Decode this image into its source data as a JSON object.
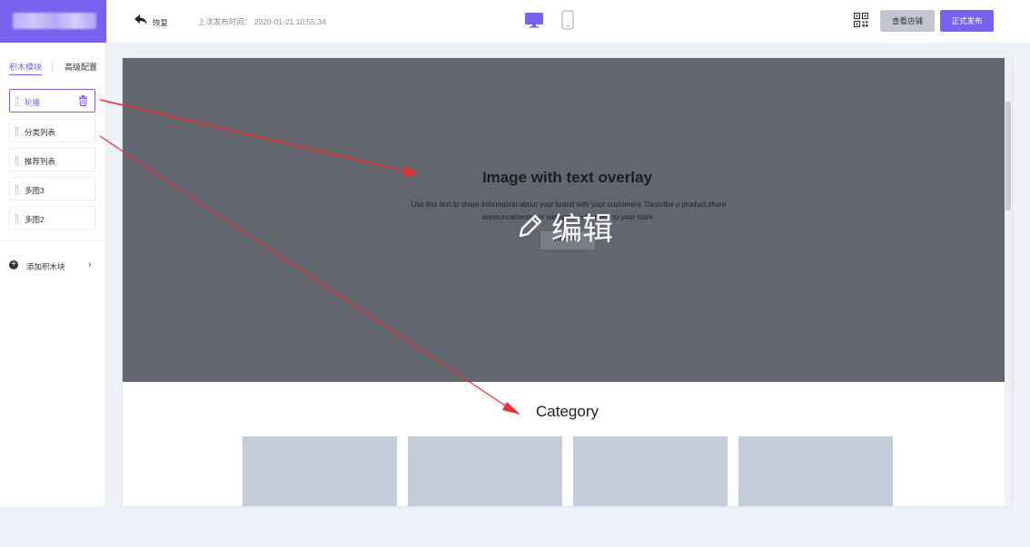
{
  "sidebar": {
    "tabs": [
      {
        "label": "积木模块",
        "active": true
      },
      {
        "label": "高级配置",
        "active": false
      }
    ],
    "blocks": [
      {
        "label": "轮播",
        "active": true
      },
      {
        "label": "分类列表",
        "active": false
      },
      {
        "label": "推荐列表",
        "active": false
      },
      {
        "label": "多图3",
        "active": false
      },
      {
        "label": "多图2",
        "active": false
      }
    ],
    "add_block_label": "添加积木块"
  },
  "topbar": {
    "undo_label": "恢复",
    "last_publish": "上次发布时间：  2020-01-21  10:55:34",
    "view_store_label": "查看店铺",
    "publish_label": "正式发布"
  },
  "canvas": {
    "hero": {
      "title": "Image with text overlay",
      "text_line1": "Use this text to share information about your brand with your customers. Describe a product,share",
      "text_line2": "announcements, or welcome customers to your store.",
      "button_label": "VIEW ALL",
      "edit_label": "编辑"
    },
    "category_title": "Category"
  },
  "colors": {
    "accent": "#7a62f0",
    "hero_bg": "#63666e",
    "tile_bg": "#c5ccd9",
    "arrow": "#e8312f"
  }
}
